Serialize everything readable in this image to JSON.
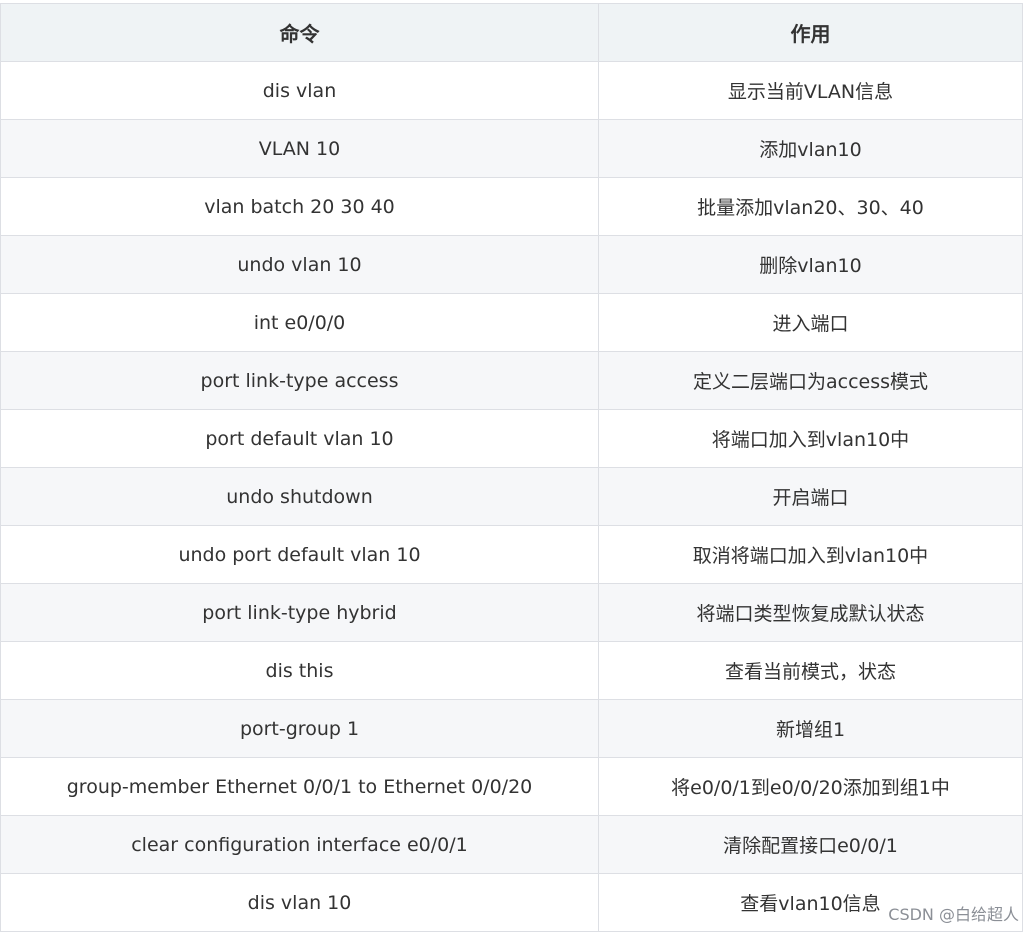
{
  "table": {
    "headers": [
      "命令",
      "作用"
    ],
    "rows": [
      {
        "command": "dis vlan",
        "purpose": "显示当前VLAN信息"
      },
      {
        "command": "VLAN 10",
        "purpose": "添加vlan10"
      },
      {
        "command": "vlan batch 20 30 40",
        "purpose": "批量添加vlan20、30、40"
      },
      {
        "command": "undo vlan 10",
        "purpose": "删除vlan10"
      },
      {
        "command": "int e0/0/0",
        "purpose": "进入端口"
      },
      {
        "command": "port link-type access",
        "purpose": "定义二层端口为access模式"
      },
      {
        "command": "port default vlan 10",
        "purpose": "将端口加入到vlan10中"
      },
      {
        "command": "undo shutdown",
        "purpose": "开启端口"
      },
      {
        "command": "undo port default vlan 10",
        "purpose": "取消将端口加入到vlan10中"
      },
      {
        "command": "port link-type hybrid",
        "purpose": "将端口类型恢复成默认状态"
      },
      {
        "command": "dis this",
        "purpose": "查看当前模式，状态"
      },
      {
        "command": "port-group 1",
        "purpose": "新增组1"
      },
      {
        "command": "group-member Ethernet 0/0/1 to Ethernet 0/0/20",
        "purpose": "将e0/0/1到e0/0/20添加到组1中"
      },
      {
        "command": "clear configuration interface e0/0/1",
        "purpose": "清除配置接口e0/0/1"
      },
      {
        "command": "dis vlan 10",
        "purpose": "查看vlan10信息"
      }
    ]
  },
  "watermark": "CSDN @白给超人"
}
